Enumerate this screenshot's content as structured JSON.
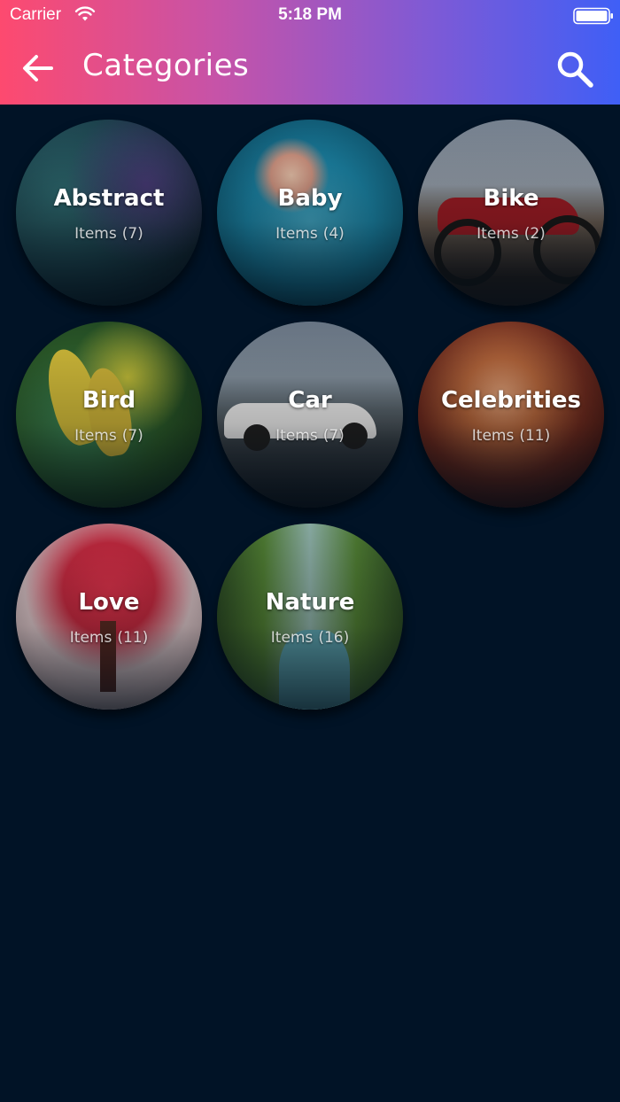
{
  "status_bar": {
    "carrier": "Carrier",
    "time": "5:18 PM"
  },
  "header": {
    "title": "Categories",
    "back_icon": "arrow-left-icon",
    "search_icon": "search-icon",
    "gradient": [
      "#fd4a6f",
      "#3f5ff6"
    ]
  },
  "background_color": "#011326",
  "items_label": "Items",
  "categories": [
    {
      "name": "Abstract",
      "count": "(7)"
    },
    {
      "name": "Baby",
      "count": "(4)"
    },
    {
      "name": "Bike",
      "count": "(2)"
    },
    {
      "name": "Bird",
      "count": "(7)"
    },
    {
      "name": "Car",
      "count": "(7)"
    },
    {
      "name": "Celebrities",
      "count": "(11)"
    },
    {
      "name": "Love",
      "count": "(11)"
    },
    {
      "name": "Nature",
      "count": "(16)"
    }
  ]
}
